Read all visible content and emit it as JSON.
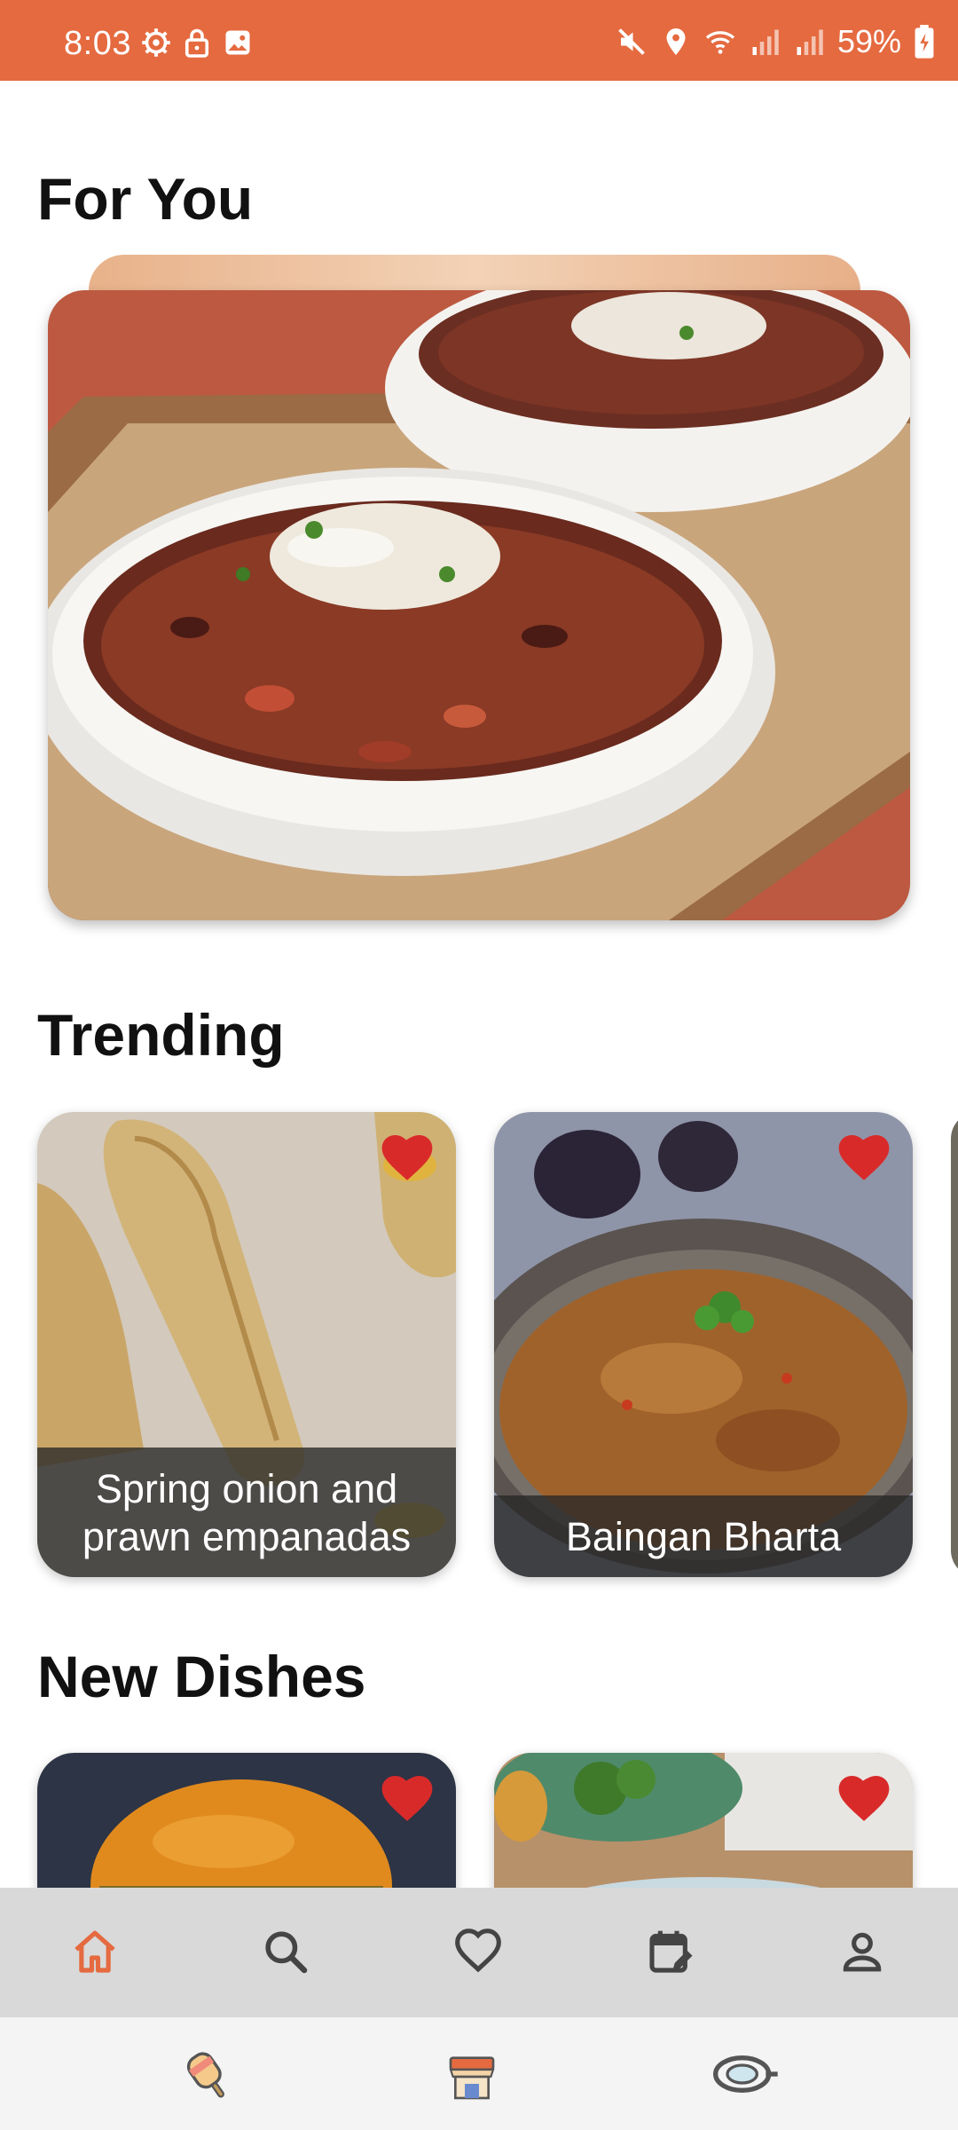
{
  "status": {
    "time": "8:03",
    "battery": "59%",
    "left_icons": [
      "gear-icon",
      "lock-icon",
      "image-icon"
    ],
    "right_icons": [
      "mute-icon",
      "location-icon",
      "wifi-icon",
      "signal-icon",
      "signal-icon",
      "battery-icon"
    ]
  },
  "sections": {
    "for_you": "For You",
    "trending": "Trending",
    "new_dishes": "New Dishes"
  },
  "trending": [
    {
      "title": "Spring onion and prawn empanadas",
      "favorited": true
    },
    {
      "title": "Baingan Bharta",
      "favorited": true
    }
  ],
  "new_dishes": [
    {
      "favorited": true
    },
    {
      "favorited": true
    }
  ],
  "bottom_nav": [
    {
      "name": "home",
      "icon": "home-icon",
      "active": true
    },
    {
      "name": "search",
      "icon": "search-icon",
      "active": false
    },
    {
      "name": "favorites",
      "icon": "heart-outline-icon",
      "active": false
    },
    {
      "name": "planner",
      "icon": "calendar-edit-icon",
      "active": false
    },
    {
      "name": "profile",
      "icon": "person-icon",
      "active": false
    }
  ],
  "colors": {
    "accent": "#e56a40",
    "heart": "#d92a2a",
    "nav_background": "#d9d9d9",
    "caption_overlay": "#282828"
  }
}
